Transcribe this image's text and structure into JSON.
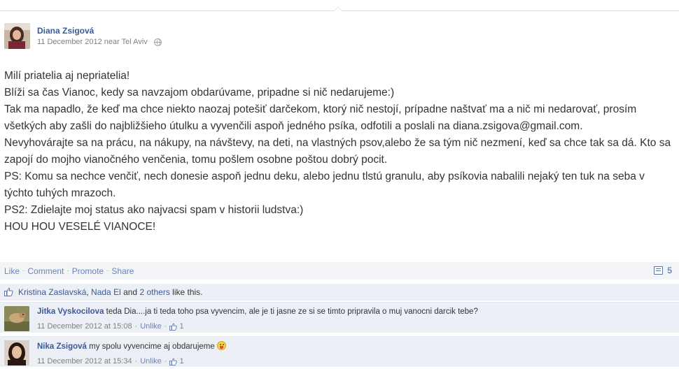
{
  "post": {
    "author": "Diana Zsigová",
    "meta": "11 December 2012 near Tel Aviv",
    "privacy_icon": "globe-icon",
    "body_lines": [
      "Milí priatelia aj nepriatelia!",
      "Blíži sa čas Vianoc, kedy sa navzajom obdarúvame, pripadne si nič nedarujeme:)",
      "Tak ma napadlo, že keď ma chce niekto naozaj potešiť darčekom, ktorý nič nestojí, prípadne naštvať ma a nič mi nedarovať, prosím všetkých aby zašli do najbližšieho útulku a vyvenčili aspoň jedného psíka, odfotili a poslali na diana.zsigova@gmail.com.",
      "Nevyhovárajte sa na prácu, na nákupy, na návštevy, na deti, na vlastných psov,alebo že sa tým nič nezmení, keď sa chce tak sa dá. Kto sa zapojí do mojho vianočného venčenia, tomu pošlem osobne poštou dobrý pocit.",
      "PS: Komu sa nechce venčiť, nech donesie aspoň jednu deku, alebo jednu tlstú granulu, aby psíkovia nabalili nejaký ten tuk na seba v týchto tuhých mrazoch.",
      "PS2: Zdielajte moj status ako najvacsi spam v historii ludstva:)",
      "HOU HOU VESELÉ VIANOCE!"
    ]
  },
  "actions": {
    "like": "Like",
    "comment": "Comment",
    "promote": "Promote",
    "share": "Share",
    "separator": "·",
    "comment_count": "5"
  },
  "likes": {
    "name1": "Kristina Zaslavská",
    "sep1": ", ",
    "name2": "Nada El",
    "and": " and ",
    "others": "2 others",
    "suffix": " like this."
  },
  "comments": [
    {
      "author": "Jitka Vyskocilova",
      "text": " teda Dia....ja ti teda toho psa vyvencim, ale je ti jasne ze si se timto pripravila o muj vanocni darcik tebe?",
      "time": "11 December 2012 at 15:08",
      "unlike": "Unlike",
      "likes": "1"
    },
    {
      "author": "Nika Zsigová",
      "text": " my spolu vyvencime aj obdarujeme",
      "time": "11 December 2012 at 15:34",
      "unlike": "Unlike",
      "likes": "1"
    }
  ],
  "colors": {
    "link": "#3b5998",
    "action": "#6d84b4",
    "panel": "#eceff5",
    "meta": "#808080"
  }
}
